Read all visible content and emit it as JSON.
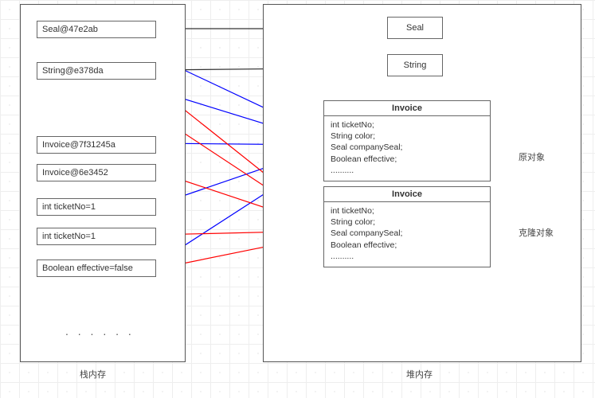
{
  "labels": {
    "stack": "栈内存",
    "heap": "堆内存",
    "original": "原对象",
    "clone": "克隆对象"
  },
  "stack": {
    "seal": "Seal@47e2ab",
    "string": "String@e378da",
    "invoice1": "Invoice@7f31245a",
    "invoice2": "Invoice@6e3452",
    "ticket1": "int ticketNo=1",
    "ticket2": "int ticketNo=1",
    "effective": "Boolean effective=false",
    "ellipsis": ". . . . . ."
  },
  "heap": {
    "seal": "Seal",
    "string": "String",
    "invoice_title": "Invoice",
    "invoice_body": "int ticketNo;\nString color;\nSeal companySeal;\nBoolean effective;\n.........."
  }
}
